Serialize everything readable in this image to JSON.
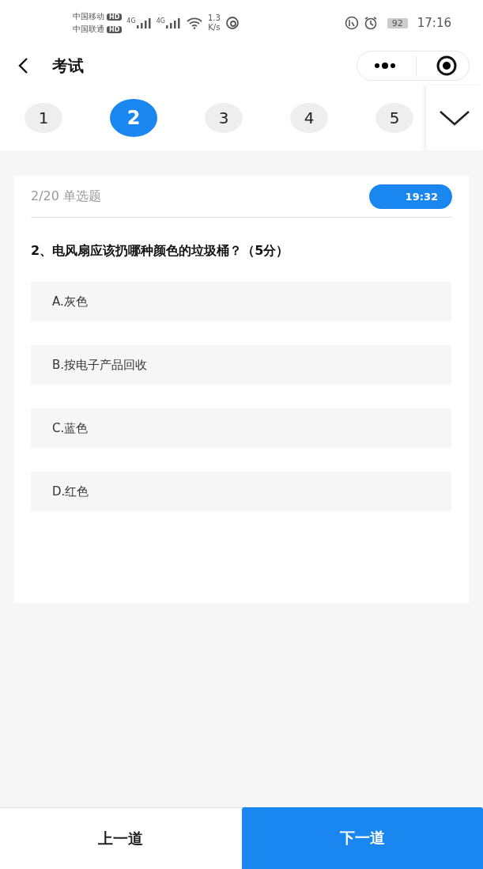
{
  "status_bar": {
    "carriers": [
      "中国移动",
      "中国联通"
    ],
    "hd": [
      "HD",
      "HD"
    ],
    "signals": [
      "4G",
      "4G"
    ],
    "speed": [
      "1.3",
      "K/s"
    ],
    "battery": "92",
    "time": "17:16"
  },
  "nav": {
    "title": "考试"
  },
  "question_tabs": [
    {
      "label": "1",
      "selected": false
    },
    {
      "label": "2",
      "selected": true
    },
    {
      "label": "3",
      "selected": false
    },
    {
      "label": "4",
      "selected": false
    },
    {
      "label": "5",
      "selected": false
    }
  ],
  "card": {
    "progress": "2/20",
    "type": "单选题",
    "timer": "19:32",
    "question": "2、电风扇应该扔哪种颜色的垃圾桶？（5分）",
    "options": [
      {
        "label": "A.灰色",
        "selected": false
      },
      {
        "label": "B.按电子产品回收",
        "selected": false
      },
      {
        "label": "C.蓝色",
        "selected": false
      },
      {
        "label": "D.红色",
        "selected": false
      }
    ]
  },
  "buttons": [
    {
      "label": "上一道",
      "kind": "secondary"
    },
    {
      "label": "下一道",
      "kind": "primary"
    }
  ]
}
